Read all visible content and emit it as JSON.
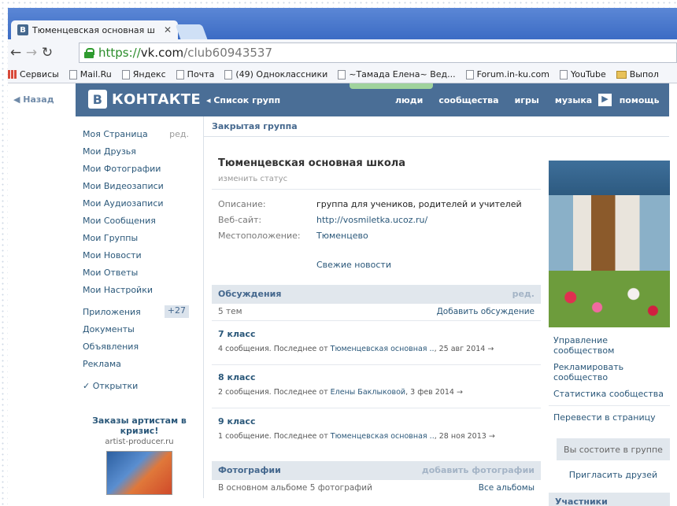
{
  "browser": {
    "tab_title": "Тюменцевская основная ш",
    "tab_favicon": "В",
    "url_scheme": "https://",
    "url_host": "vk.com",
    "url_path": "/club60943537",
    "bookmarks": [
      "Сервисы",
      "Mail.Ru",
      "Яндекс",
      "Почта",
      "(49) Одноклассники",
      "~Тамада Елена~ Вед...",
      "Forum.in-ku.com",
      "YouTube",
      "Выпол"
    ]
  },
  "header": {
    "back": "◀ Назад",
    "logo_b": "В",
    "logo_text": "КОНТАКТЕ",
    "group_list": "◂ Список групп",
    "nav": [
      "люди",
      "сообщества",
      "игры",
      "музыка",
      "помощь"
    ],
    "nav_arrow": "▶"
  },
  "left_menu": {
    "items": [
      "Моя Страница",
      "Мои Друзья",
      "Мои Фотографии",
      "Мои Видеозаписи",
      "Мои Аудиозаписи",
      "Мои Сообщения",
      "Мои Группы",
      "Мои Новости",
      "Мои Ответы",
      "Мои Настройки"
    ],
    "edit": "ред.",
    "apps": "Приложения",
    "apps_badge": "+27",
    "extra": [
      "Документы",
      "Объявления",
      "Реклама"
    ],
    "postcards": "✓ Открытки",
    "ad_title": "Заказы артистам в кризис!",
    "ad_site": "artist-producer.ru"
  },
  "group": {
    "closed": "Закрытая группа",
    "name": "Тюменцевская основная школа",
    "status": "изменить статус",
    "desc_label": "Описание:",
    "desc_value": "группа для учеников, родителей и учителей",
    "site_label": "Веб-сайт:",
    "site_value": "http://vosmiletka.ucoz.ru/",
    "loc_label": "Местоположение:",
    "loc_value": "Тюменцево",
    "news": "Свежие новости"
  },
  "discussions": {
    "title": "Обсуждения",
    "edit": "ред.",
    "count": "5 тем",
    "add": "Добавить обсуждение",
    "topics": [
      {
        "title": "7 класс",
        "pre": "4 сообщения. Последнее от ",
        "author": "Тюменцевская основная ..",
        "date": ", 25 авг 2014  →"
      },
      {
        "title": "8 класс",
        "pre": "2 сообщения. Последнее от ",
        "author": "Елены Баклыковой",
        "date": ", 3 фев 2014  →"
      },
      {
        "title": "9 класс",
        "pre": "1 сообщение. Последнее от ",
        "author": "Тюменцевская основная ..",
        "date": ", 28 ноя 2013  →"
      }
    ]
  },
  "photos": {
    "title": "Фотографии",
    "add": "добавить фотографии",
    "sub": "В основном альбоме 5 фотографий",
    "all": "Все альбомы"
  },
  "right": {
    "links": [
      "Управление сообществом",
      "Рекламировать сообщество",
      "Статистика сообщества"
    ],
    "transfer": "Перевести в страницу",
    "member": "Вы состоите в группе",
    "invite": "Пригласить друзей",
    "members_title": "Участники"
  }
}
